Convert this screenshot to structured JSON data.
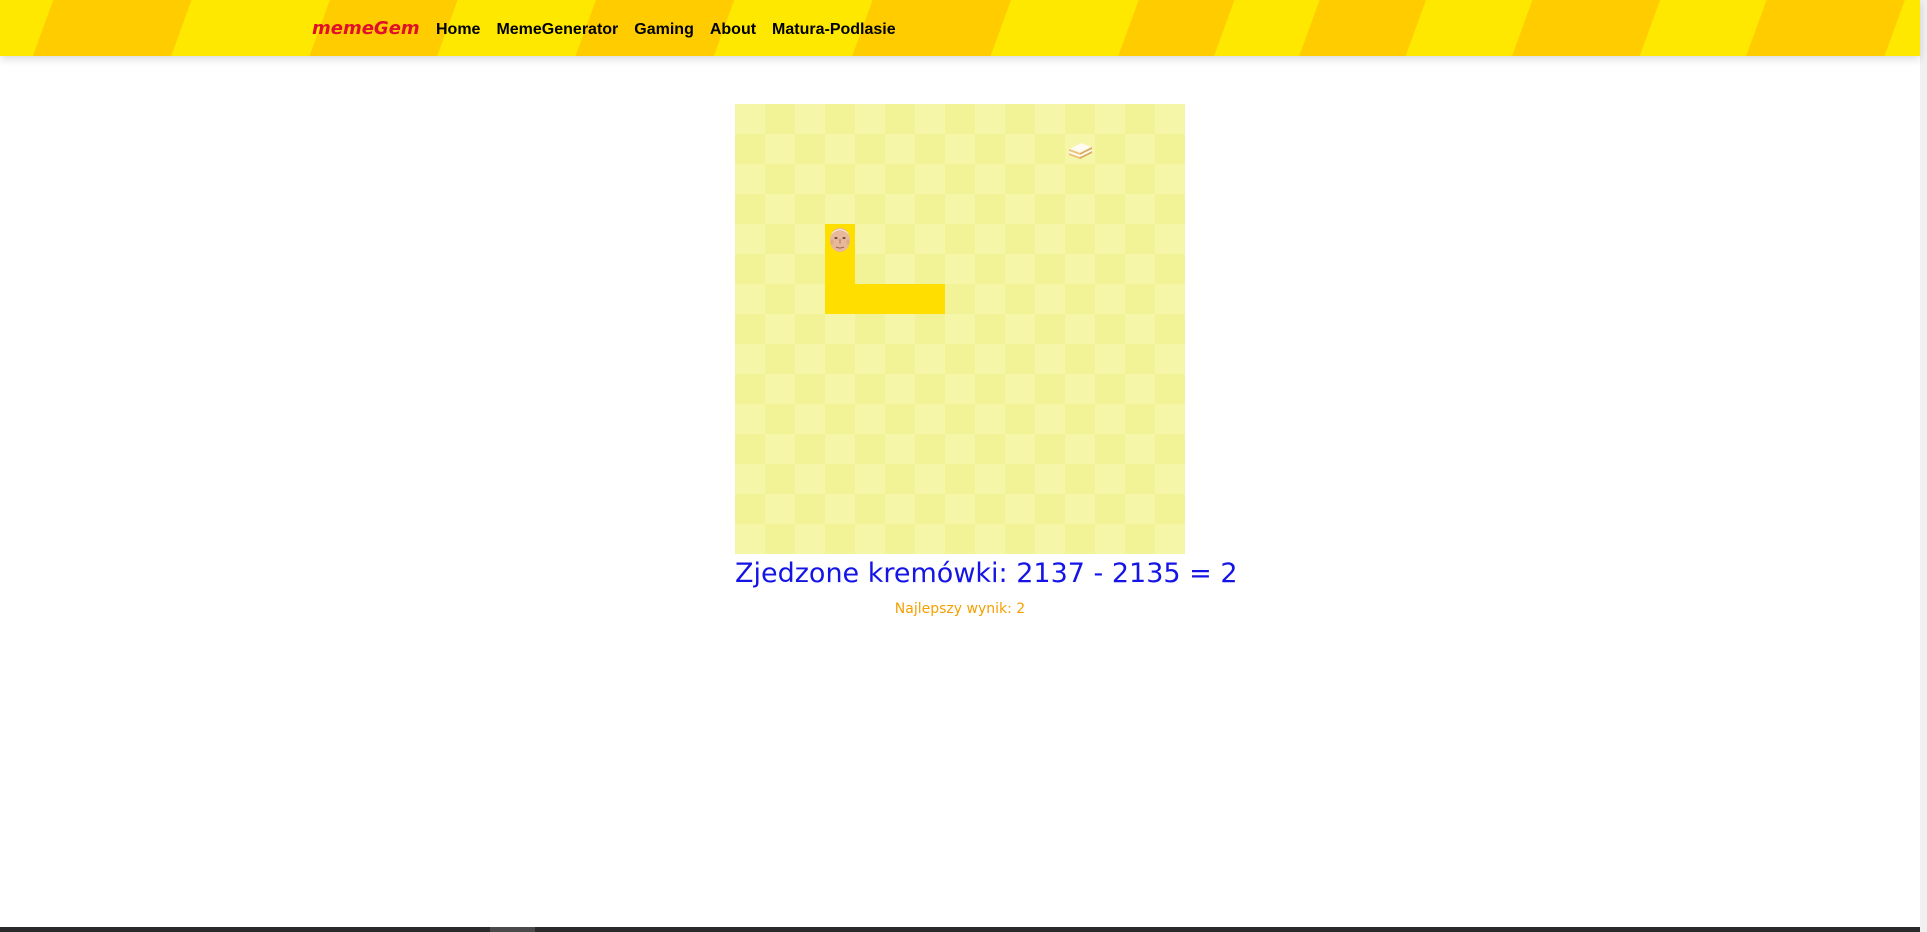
{
  "navbar": {
    "brand": "memeGem",
    "links": [
      "Home",
      "MemeGenerator",
      "Gaming",
      "About",
      "Matura-Podlasie"
    ]
  },
  "game": {
    "grid_size": 15,
    "snake_head": {
      "col": 3,
      "row": 4,
      "icon": "pope-face-icon"
    },
    "snake_body": [
      {
        "col": 3,
        "row": 5
      },
      {
        "col": 3,
        "row": 6
      },
      {
        "col": 4,
        "row": 6
      },
      {
        "col": 5,
        "row": 6
      },
      {
        "col": 6,
        "row": 6
      }
    ],
    "food": {
      "col": 11,
      "row": 1,
      "icon": "kremowka-cake-icon"
    },
    "colors": {
      "snake": "#ffde00",
      "board_light": "#f6f6a8",
      "board_dark": "#f2f296"
    }
  },
  "score": {
    "text": "Zjedzone kremówki: 2137 - 2135 = 2",
    "best": "Najlepszy wynik: 2"
  }
}
